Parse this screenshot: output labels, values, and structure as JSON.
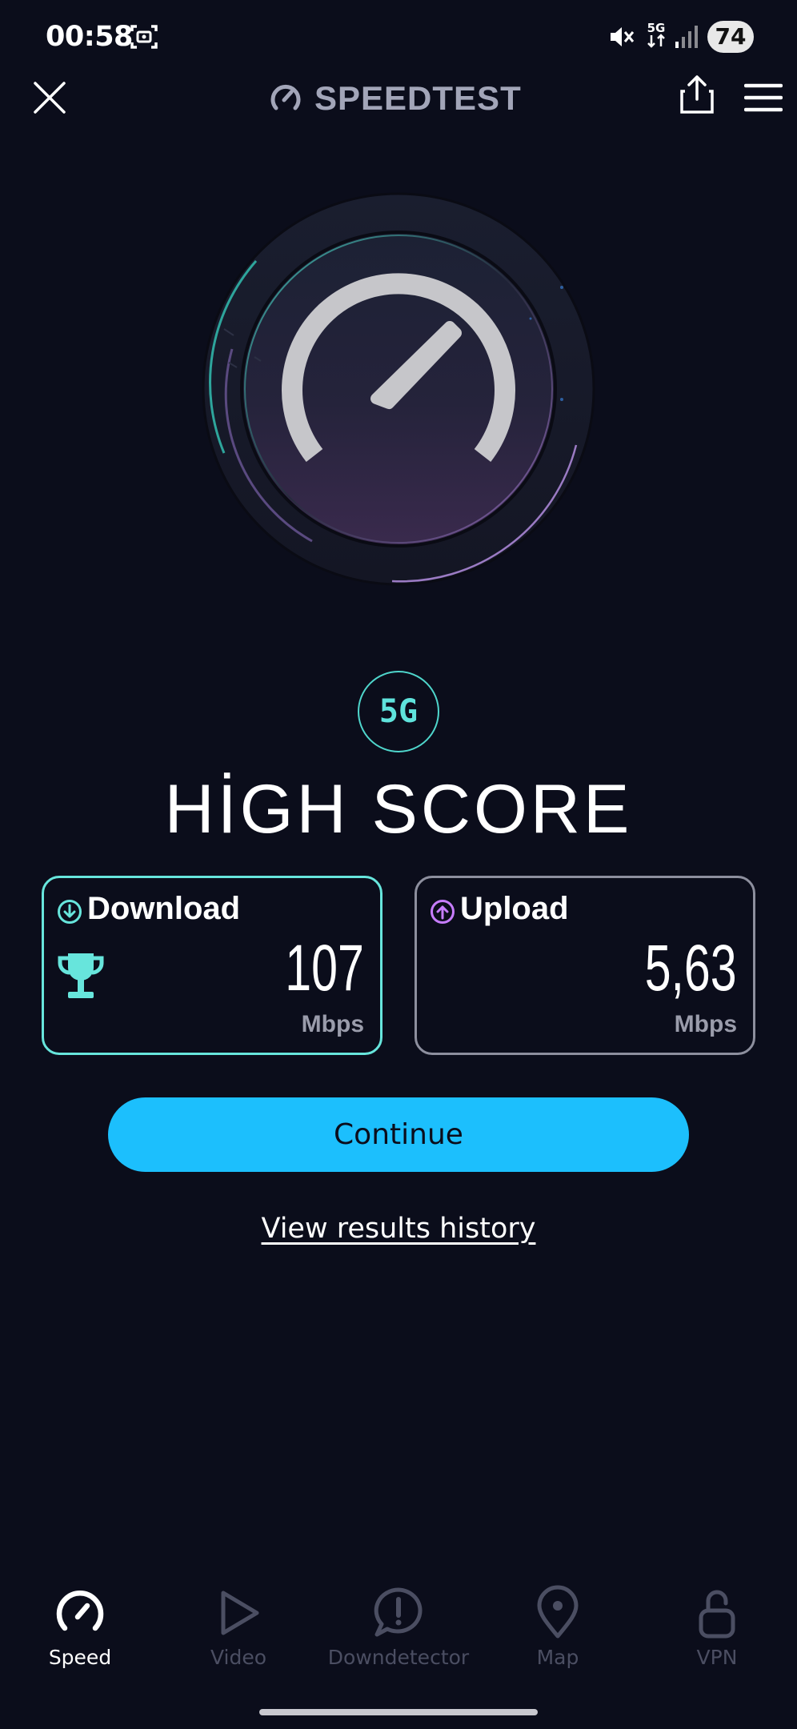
{
  "status_bar": {
    "time": "00:58",
    "network": "5G",
    "battery": "74"
  },
  "header": {
    "title": "SPEEDTEST",
    "icons": [
      "close-icon",
      "speedometer-icon",
      "share-icon",
      "menu-icon"
    ]
  },
  "result": {
    "network_badge": "5G",
    "headline": "HİGH SCORE",
    "download": {
      "label": "Download",
      "value": "107",
      "unit": "Mbps",
      "icon": "download-arrow-icon",
      "badge_icon": "trophy-icon"
    },
    "upload": {
      "label": "Upload",
      "value": "5,63",
      "unit": "Mbps",
      "icon": "upload-arrow-icon"
    }
  },
  "actions": {
    "continue_label": "Continue",
    "history_label": "View results history"
  },
  "bottom_nav": {
    "items": [
      {
        "label": "Speed",
        "icon": "speedometer-icon",
        "active": true
      },
      {
        "label": "Video",
        "icon": "play-icon",
        "active": false
      },
      {
        "label": "Downdetector",
        "icon": "alert-icon",
        "active": false
      },
      {
        "label": "Map",
        "icon": "map-pin-icon",
        "active": false
      },
      {
        "label": "VPN",
        "icon": "unlocked-icon",
        "active": false
      }
    ]
  },
  "colors": {
    "background": "#0b0d1b",
    "accent_cyan": "#1cbffd",
    "download_border": "#67e5dc",
    "upload_accent": "#c77dff"
  }
}
